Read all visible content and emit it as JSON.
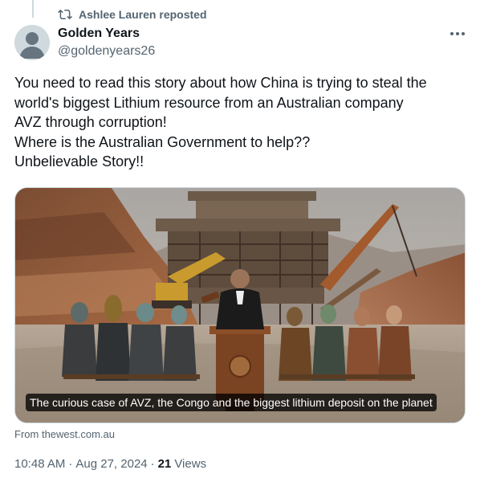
{
  "repost": {
    "label": "Ashlee Lauren reposted",
    "icon": "repost-icon"
  },
  "author": {
    "display_name": "Golden Years",
    "handle": "@goldenyears26",
    "avatar_icon": "default-avatar-icon"
  },
  "more_icon": "more-options-icon",
  "tweet": {
    "lines": [
      "You need to read this story about how China is trying to steal the",
      "world's biggest Lithium resource from an Australian company",
      "AVZ through corruption!",
      "Where is the Australian Government to help??",
      "Unbelievable Story!!"
    ]
  },
  "card": {
    "caption": "The curious case of AVZ, the Congo and the biggest lithium deposit on the planet",
    "image_icon": "mining-site-illustration"
  },
  "source": {
    "prefix": "From ",
    "domain": "thewest.com.au"
  },
  "meta": {
    "time": "10:48 AM",
    "sep1": "·",
    "date": "Aug 27, 2024",
    "sep2": "·",
    "views_count": "21",
    "views_label": "Views"
  },
  "colors": {
    "text_primary": "#0f1419",
    "text_secondary": "#536471",
    "border": "#cfd9de"
  }
}
